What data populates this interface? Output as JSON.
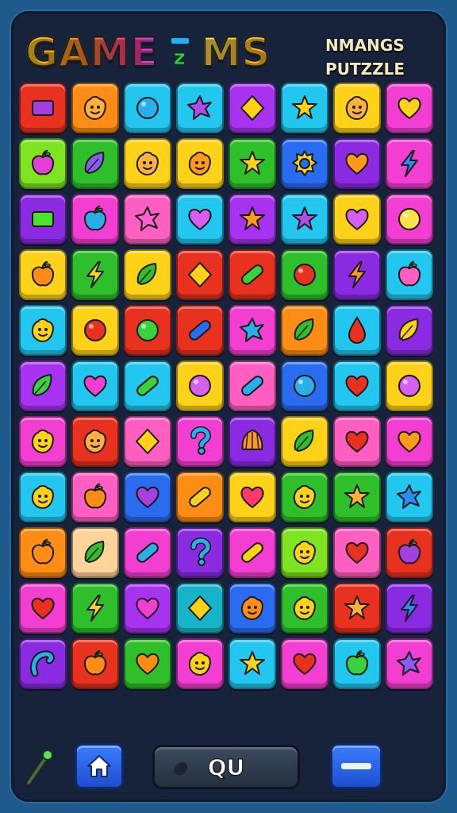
{
  "header": {
    "title_left": "GAME",
    "title_badge": "z",
    "title_right": "MS",
    "subtitle_line1": "NMANGS",
    "subtitle_line2": "PUTZZLE"
  },
  "controls": {
    "main_button_label": "QU"
  },
  "colors": {
    "red": "#e8321f",
    "orange": "#ff8c14",
    "yellow": "#ffd21a",
    "lime": "#7ee321",
    "green": "#2fbf2a",
    "cyan": "#22c6ee",
    "blue": "#2a6cf0",
    "purple": "#8a2be2",
    "violet": "#a733f0",
    "magenta": "#f23fd2",
    "pink": "#ff5fc0",
    "peach": "#ffd49a",
    "teal": "#17b3c9",
    "cream": "#f5ef8a"
  },
  "board": {
    "rows": [
      [
        [
          "red",
          "rect",
          "#a43fe0"
        ],
        [
          "orange",
          "face",
          "#ffb13a"
        ],
        [
          "cyan",
          "circle",
          "#2ab0e8"
        ],
        [
          "cyan",
          "star4",
          "#b24be8"
        ],
        [
          "violet",
          "diamond",
          "#ffd21a"
        ],
        [
          "cyan",
          "star",
          "#ffd21a"
        ],
        [
          "yellow",
          "face",
          "#ffb13a"
        ],
        [
          "magenta",
          "heart",
          "#ffd21a"
        ]
      ],
      [
        [
          "lime",
          "apple",
          "#e23fd6"
        ],
        [
          "green",
          "leaf",
          "#8b5cf0"
        ],
        [
          "yellow",
          "face",
          "#ffb13a"
        ],
        [
          "yellow",
          "face",
          "#ff9a1a"
        ],
        [
          "green",
          "star",
          "#ffd21a"
        ],
        [
          "blue",
          "gear",
          "#ffd21a"
        ],
        [
          "purple",
          "heart",
          "#ff9a1a"
        ],
        [
          "magenta",
          "bolt",
          "#2a8cf0"
        ]
      ],
      [
        [
          "purple",
          "rect",
          "#4be32a"
        ],
        [
          "magenta",
          "apple",
          "#2ab0e8"
        ],
        [
          "pink",
          "star4",
          "#ff5fd0"
        ],
        [
          "cyan",
          "heart",
          "#d65ff0"
        ],
        [
          "violet",
          "star",
          "#ff9a1a"
        ],
        [
          "cyan",
          "star",
          "#b24be8"
        ],
        [
          "yellow",
          "heart",
          "#d65ff0"
        ],
        [
          "magenta",
          "circle",
          "#ffe14a"
        ]
      ],
      [
        [
          "yellow",
          "apple",
          "#ff8c14"
        ],
        [
          "green",
          "bolt",
          "#ffd21a"
        ],
        [
          "yellow",
          "leaf",
          "#2fbf2a"
        ],
        [
          "red",
          "diamond",
          "#ffd21a"
        ],
        [
          "red",
          "pill",
          "#3ad23a"
        ],
        [
          "green",
          "circle",
          "#e8321f"
        ],
        [
          "purple",
          "bolt",
          "#ff9a1a"
        ],
        [
          "cyan",
          "apple",
          "#ff5fc0"
        ]
      ],
      [
        [
          "cyan",
          "face",
          "#ffd21a"
        ],
        [
          "yellow",
          "circle",
          "#e8321f"
        ],
        [
          "red",
          "circle",
          "#3ad23a"
        ],
        [
          "red",
          "pill",
          "#2a6cf0"
        ],
        [
          "magenta",
          "star4",
          "#2ab0e8"
        ],
        [
          "orange",
          "leaf",
          "#2fbf2a"
        ],
        [
          "cyan",
          "drop",
          "#e8321f"
        ],
        [
          "purple",
          "leaf",
          "#ffd21a"
        ]
      ],
      [
        [
          "violet",
          "leaf",
          "#3ad23a"
        ],
        [
          "cyan",
          "heart",
          "#f23fd2"
        ],
        [
          "cyan",
          "pill",
          "#3ad23a"
        ],
        [
          "yellow",
          "circle",
          "#d65ff0"
        ],
        [
          "pink",
          "pill",
          "#2ab0e8"
        ],
        [
          "blue",
          "circle",
          "#2ab0e8"
        ],
        [
          "cyan",
          "heart",
          "#e8321f"
        ],
        [
          "yellow",
          "circle",
          "#d65ff0"
        ]
      ],
      [
        [
          "magenta",
          "face",
          "#ffd21a"
        ],
        [
          "red",
          "face",
          "#ffb13a"
        ],
        [
          "pink",
          "diamond",
          "#ffd21a"
        ],
        [
          "magenta",
          "question",
          "#2ab0e8"
        ],
        [
          "purple",
          "shell",
          "#ff9a1a"
        ],
        [
          "yellow",
          "leaf",
          "#2fbf2a"
        ],
        [
          "pink",
          "heart",
          "#e8321f"
        ],
        [
          "magenta",
          "heart",
          "#ff9a1a"
        ]
      ],
      [
        [
          "cyan",
          "face",
          "#ffd21a"
        ],
        [
          "pink",
          "apple",
          "#ff8c14"
        ],
        [
          "blue",
          "heart",
          "#a43fe0"
        ],
        [
          "orange",
          "pill",
          "#ffd21a"
        ],
        [
          "yellow",
          "heart",
          "#ff3a6a"
        ],
        [
          "green",
          "face",
          "#ffd21a"
        ],
        [
          "green",
          "star",
          "#ffb13a"
        ],
        [
          "cyan",
          "star4",
          "#2a8cf0"
        ]
      ],
      [
        [
          "orange",
          "apple",
          "#ff8c14"
        ],
        [
          "peach",
          "leaf",
          "#2fbf2a"
        ],
        [
          "magenta",
          "pill",
          "#2ab0e8"
        ],
        [
          "purple",
          "question",
          "#2ab0e8"
        ],
        [
          "magenta",
          "pill",
          "#ffd21a"
        ],
        [
          "lime",
          "face",
          "#ffd21a"
        ],
        [
          "pink",
          "heart",
          "#e8321f"
        ],
        [
          "red",
          "apple",
          "#a43fe0"
        ]
      ],
      [
        [
          "magenta",
          "heart",
          "#e8321f"
        ],
        [
          "green",
          "bolt",
          "#ffd21a"
        ],
        [
          "violet",
          "heart",
          "#f23fd2"
        ],
        [
          "teal",
          "diamond",
          "#ffd21a"
        ],
        [
          "blue",
          "face",
          "#ff8c14"
        ],
        [
          "green",
          "face",
          "#ffd21a"
        ],
        [
          "red",
          "star",
          "#ffb13a"
        ],
        [
          "purple",
          "bolt",
          "#2a8cf0"
        ]
      ],
      [
        [
          "purple",
          "hook",
          "#2ab0e8"
        ],
        [
          "red",
          "apple",
          "#ff8c14"
        ],
        [
          "green",
          "heart",
          "#ff8c14"
        ],
        [
          "magenta",
          "face",
          "#ffd21a"
        ],
        [
          "cyan",
          "star",
          "#ffd21a"
        ],
        [
          "magenta",
          "heart",
          "#e8321f"
        ],
        [
          "cyan",
          "apple",
          "#3ad23a"
        ],
        [
          "magenta",
          "star4",
          "#8b5cf0"
        ]
      ]
    ]
  }
}
